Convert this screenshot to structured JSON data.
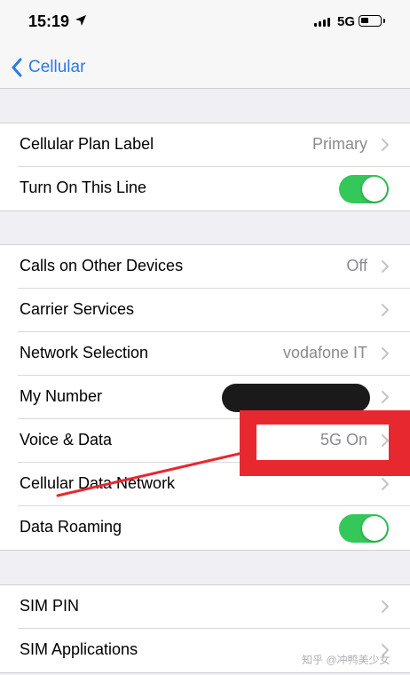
{
  "status_bar": {
    "time": "15:19",
    "network": "5G"
  },
  "nav": {
    "back_label": "Cellular"
  },
  "groups": [
    {
      "rows": [
        {
          "label": "Cellular Plan Label",
          "value": "Primary",
          "type": "disclosure"
        },
        {
          "label": "Turn On This Line",
          "type": "toggle",
          "on": true
        }
      ]
    },
    {
      "rows": [
        {
          "label": "Calls on Other Devices",
          "value": "Off",
          "type": "disclosure"
        },
        {
          "label": "Carrier Services",
          "value": "",
          "type": "disclosure"
        },
        {
          "label": "Network Selection",
          "value": "vodafone IT",
          "type": "disclosure"
        },
        {
          "label": "My Number",
          "value": "",
          "type": "disclosure",
          "redacted": true
        },
        {
          "label": "Voice & Data",
          "value": "5G On",
          "type": "disclosure",
          "highlighted": true
        },
        {
          "label": "Cellular Data Network",
          "value": "",
          "type": "disclosure"
        },
        {
          "label": "Data Roaming",
          "type": "toggle",
          "on": true
        }
      ]
    },
    {
      "rows": [
        {
          "label": "SIM PIN",
          "value": "",
          "type": "disclosure"
        },
        {
          "label": "SIM Applications",
          "value": "",
          "type": "disclosure"
        }
      ]
    }
  ],
  "colors": {
    "accent": "#2b7ae6",
    "toggle_on": "#34c759",
    "annotation": "#e8282f"
  },
  "watermark": "知乎 @冲鸭美少女"
}
